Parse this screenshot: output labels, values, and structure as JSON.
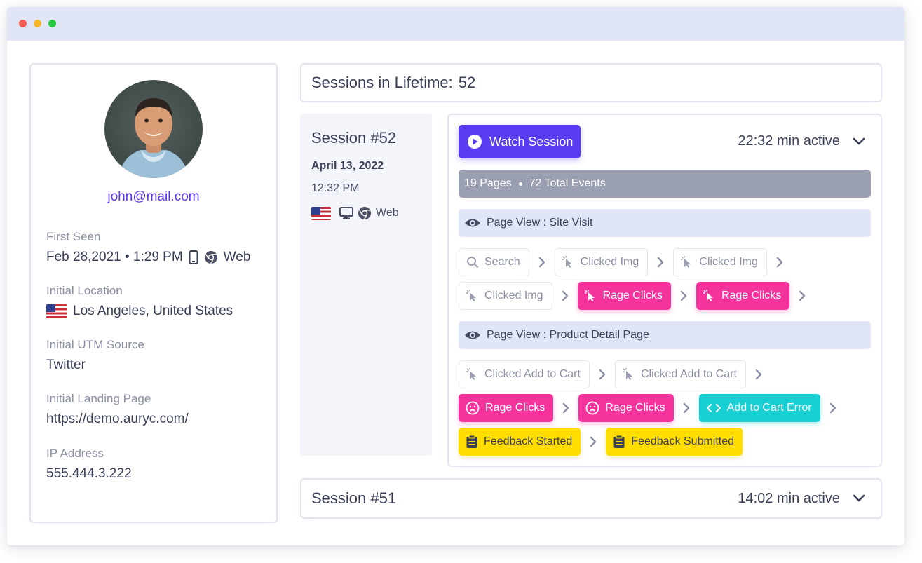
{
  "profile": {
    "email": "john@mail.com",
    "first_seen": {
      "label": "First Seen",
      "value": "Feb 28,2021 • 1:29 PM",
      "platform": "Web",
      "icons": [
        "mobile-icon",
        "chrome-icon"
      ]
    },
    "initial_location": {
      "label": "Initial Location",
      "value": "Los Angeles, United States",
      "flag": "us-flag"
    },
    "initial_utm_source": {
      "label": "Initial UTM Source",
      "value": "Twitter"
    },
    "initial_landing_page": {
      "label": "Initial Landing Page",
      "value": "https://demo.auryc.com/"
    },
    "ip_address": {
      "label": "IP Address",
      "value": "555.444.3.222"
    }
  },
  "lifetime": {
    "label": "Sessions in Lifetime:",
    "count": "52"
  },
  "session_current": {
    "title": "Session #52",
    "date": "April 13, 2022",
    "time": "12:32 PM",
    "platform": "Web",
    "watch_label": "Watch Session",
    "active": "22:32 min active",
    "summary": {
      "pages": "19 Pages",
      "events": "72 Total Events"
    },
    "page_views": [
      {
        "label": "Page View : Site Visit",
        "rows": [
          [
            {
              "type": "plain",
              "icon": "search-icon",
              "label": "Search"
            },
            {
              "type": "plain",
              "icon": "cursor-icon",
              "label": "Clicked Img"
            },
            {
              "type": "plain",
              "icon": "cursor-icon",
              "label": "Clicked Img"
            }
          ],
          [
            {
              "type": "plain",
              "icon": "cursor-icon",
              "label": "Clicked Img"
            },
            {
              "type": "rage",
              "icon": "cursor-icon",
              "label": "Rage Clicks"
            },
            {
              "type": "rage",
              "icon": "cursor-icon",
              "label": "Rage Clicks"
            }
          ]
        ]
      },
      {
        "label": "Page View : Product Detail Page",
        "rows": [
          [
            {
              "type": "plain",
              "icon": "cursor-icon",
              "label": "Clicked Add to Cart"
            },
            {
              "type": "plain",
              "icon": "cursor-icon",
              "label": "Clicked Add to Cart"
            }
          ],
          [
            {
              "type": "rage",
              "icon": "frown-icon",
              "label": "Rage Clicks"
            },
            {
              "type": "rage",
              "icon": "frown-icon",
              "label": "Rage Clicks"
            },
            {
              "type": "error",
              "icon": "code-icon",
              "label": "Add to Cart Error"
            }
          ],
          [
            {
              "type": "feedback",
              "icon": "clipboard-icon",
              "label": "Feedback Started"
            },
            {
              "type": "feedback",
              "icon": "clipboard-icon",
              "label": "Feedback Submitted"
            }
          ]
        ]
      }
    ]
  },
  "session_prev": {
    "title": "Session #51",
    "active": "14:02 min active"
  },
  "colors": {
    "accent": "#5a3cf0",
    "rage": "#f5339d",
    "error": "#18cfd3",
    "feedback": "#ffdd00",
    "summary_bar": "#9a9fb2",
    "pageview_bar": "#e1e6f6"
  }
}
